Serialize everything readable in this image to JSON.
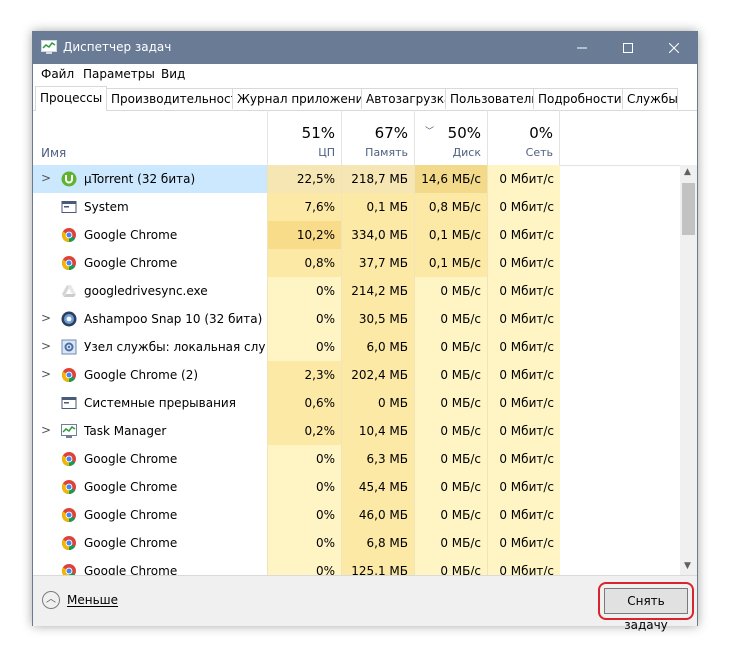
{
  "window": {
    "title": "Диспетчер задач"
  },
  "menu": [
    "Файл",
    "Параметры",
    "Вид"
  ],
  "tabs": [
    "Процессы",
    "Производительность",
    "Журнал приложений",
    "Автозагрузка",
    "Пользователи",
    "Подробности",
    "Службы"
  ],
  "active_tab": 0,
  "columns": {
    "name_label": "Имя",
    "cpu": {
      "pct": "51%",
      "label": "ЦП"
    },
    "memory": {
      "pct": "67%",
      "label": "Память"
    },
    "disk": {
      "pct": "50%",
      "label": "Диск"
    },
    "network": {
      "pct": "0%",
      "label": "Сеть"
    }
  },
  "processes": [
    {
      "name": "µTorrent (32 бита)",
      "cpu": "22,5%",
      "mem": "218,7 МБ",
      "disk": "14,6 МБ/с",
      "net": "0 Мбит/с",
      "expandable": true,
      "icon": "utorrent-icon",
      "selected": true
    },
    {
      "name": "System",
      "cpu": "7,6%",
      "mem": "0,1 МБ",
      "disk": "0,8 МБ/с",
      "net": "0 Мбит/с",
      "expandable": false,
      "icon": "system-window-icon"
    },
    {
      "name": "Google Chrome",
      "cpu": "10,2%",
      "mem": "334,0 МБ",
      "disk": "0,1 МБ/с",
      "net": "0 Мбит/с",
      "expandable": false,
      "icon": "chrome-icon"
    },
    {
      "name": "Google Chrome",
      "cpu": "0,8%",
      "mem": "37,7 МБ",
      "disk": "0,1 МБ/с",
      "net": "0 Мбит/с",
      "expandable": false,
      "icon": "chrome-icon"
    },
    {
      "name": "googledrivesync.exe",
      "cpu": "0%",
      "mem": "214,2 МБ",
      "disk": "0 МБ/с",
      "net": "0 Мбит/с",
      "expandable": false,
      "icon": "google-drive-icon"
    },
    {
      "name": "Ashampoo Snap 10 (32 бита)",
      "cpu": "0%",
      "mem": "30,5 МБ",
      "disk": "0 МБ/с",
      "net": "0 Мбит/с",
      "expandable": true,
      "icon": "ashampoo-snap-icon"
    },
    {
      "name": "Узел службы: локальная служ...",
      "cpu": "0%",
      "mem": "6,0 МБ",
      "disk": "0 МБ/с",
      "net": "0 Мбит/с",
      "expandable": true,
      "icon": "service-host-icon"
    },
    {
      "name": "Google Chrome (2)",
      "cpu": "2,3%",
      "mem": "202,4 МБ",
      "disk": "0 МБ/с",
      "net": "0 Мбит/с",
      "expandable": true,
      "icon": "chrome-icon"
    },
    {
      "name": "Системные прерывания",
      "cpu": "0,6%",
      "mem": "0 МБ",
      "disk": "0 МБ/с",
      "net": "0 Мбит/с",
      "expandable": false,
      "icon": "system-window-icon"
    },
    {
      "name": "Task Manager",
      "cpu": "0,2%",
      "mem": "10,4 МБ",
      "disk": "0 МБ/с",
      "net": "0 Мбит/с",
      "expandable": true,
      "icon": "task-manager-icon"
    },
    {
      "name": "Google Chrome",
      "cpu": "0%",
      "mem": "6,3 МБ",
      "disk": "0 МБ/с",
      "net": "0 Мбит/с",
      "expandable": false,
      "icon": "chrome-icon"
    },
    {
      "name": "Google Chrome",
      "cpu": "0%",
      "mem": "45,4 МБ",
      "disk": "0 МБ/с",
      "net": "0 Мбит/с",
      "expandable": false,
      "icon": "chrome-icon"
    },
    {
      "name": "Google Chrome",
      "cpu": "0%",
      "mem": "46,0 МБ",
      "disk": "0 МБ/с",
      "net": "0 Мбит/с",
      "expandable": false,
      "icon": "chrome-icon"
    },
    {
      "name": "Google Chrome",
      "cpu": "0%",
      "mem": "6,8 МБ",
      "disk": "0 МБ/с",
      "net": "0 Мбит/с",
      "expandable": false,
      "icon": "chrome-icon"
    },
    {
      "name": "Google Chrome",
      "cpu": "0%",
      "mem": "125,1 МБ",
      "disk": "0 МБ/с",
      "net": "0 Мбит/с",
      "expandable": false,
      "icon": "chrome-icon"
    }
  ],
  "footer": {
    "less_label": "Меньше",
    "end_task_label": "Снять задачу"
  },
  "colors": {
    "titlebar": "#6a7b96",
    "selected_row": "#cce8ff",
    "heat_low": "#fff4c4",
    "heat_mid": "#fce9a6",
    "heat_high": "#f9dc8a",
    "end_task_highlight": "#d9232d"
  }
}
